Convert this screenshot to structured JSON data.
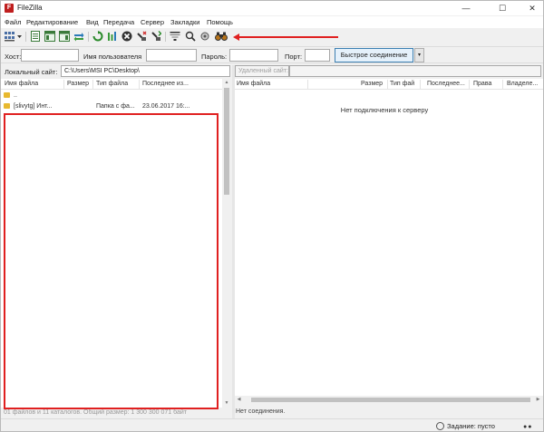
{
  "window": {
    "title": "FileZilla",
    "icon_letter": "F",
    "controls": {
      "minimize": "—",
      "maximize": "☐",
      "close": "✕"
    }
  },
  "menu": {
    "items": [
      "Файл",
      "Редактирование",
      "Вид",
      "Передача",
      "Сервер",
      "Закладки",
      "Помощь"
    ]
  },
  "toolbar": {
    "icons": [
      "site-manager-icon",
      "dropdown-arrow-icon",
      "toggle-message-log-icon",
      "toggle-local-tree-icon",
      "toggle-remote-tree-icon",
      "toggle-transfer-queue-icon",
      "refresh-icon",
      "process-queue-icon",
      "cancel-icon",
      "disconnect-icon",
      "reconnect-icon",
      "filter-icon",
      "toggle-compare-icon",
      "sync-browse-icon",
      "search-binoculars-icon"
    ]
  },
  "quickconnect": {
    "host_label": "Хост:",
    "user_label": "Имя пользователя",
    "pass_label": "Пароль:",
    "port_label": "Порт:",
    "host_value": "",
    "user_value": "",
    "pass_value": "",
    "port_value": "",
    "connect_button": "Быстрое соединение",
    "dropdown_glyph": "▾"
  },
  "local": {
    "site_label": "Локальный сайт:",
    "site_path": "C:\\Users\\MSI PC\\Desktop\\",
    "columns": [
      "Имя файла",
      "Размер",
      "Тип файла",
      "Последнее из..."
    ],
    "rows": [
      {
        "name": "..",
        "size": "",
        "type": "",
        "modified": ""
      },
      {
        "name": "[slivytg] Инт...",
        "size": "",
        "type": "Папка с фа...",
        "modified": "23.06.2017 16:..."
      }
    ],
    "status": "01 файлов и 11 каталогов. Общий размер: 1 300 300 071 байт"
  },
  "remote": {
    "site_label": "Удаленный сайт:",
    "site_path": "",
    "columns": [
      "Имя файла",
      "Размер",
      "Тип фай",
      "Последнее...",
      "Права",
      "Владеле..."
    ],
    "empty_message": "Нет подключения к серверу",
    "status": "Нет соединения."
  },
  "statusbar": {
    "queue": "Задание: пусто",
    "dots": "●●"
  },
  "colors": {
    "annotation_red": "#e02020",
    "accent_blue": "#3c7fb1"
  }
}
